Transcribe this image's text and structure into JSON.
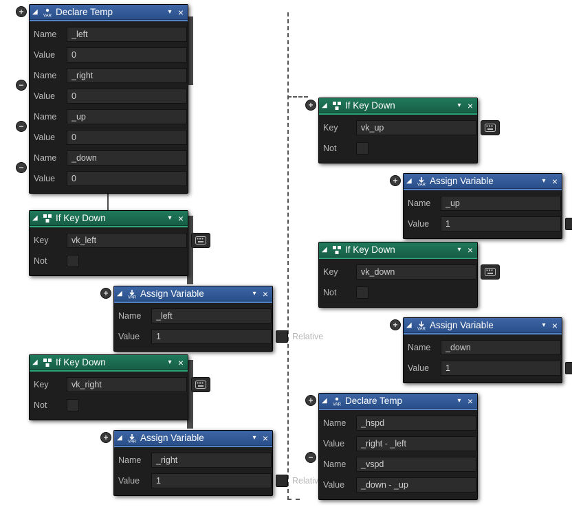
{
  "labels": {
    "name": "Name",
    "value": "Value",
    "key": "Key",
    "not": "Not",
    "relative": "Relative"
  },
  "titles": {
    "declare_temp": "Declare Temp",
    "if_key_down": "If Key Down",
    "assign_variable": "Assign Variable"
  },
  "declare1": {
    "fields": [
      {
        "name": "_left",
        "value": "0"
      },
      {
        "name": "_right",
        "value": "0"
      },
      {
        "name": "_up",
        "value": "0"
      },
      {
        "name": "_down",
        "value": "0"
      }
    ]
  },
  "if_left": {
    "key": "vk_left"
  },
  "assign_left": {
    "name": "_left",
    "value": "1"
  },
  "if_right": {
    "key": "vk_right"
  },
  "assign_right": {
    "name": "_right",
    "value": "1"
  },
  "if_up": {
    "key": "vk_up"
  },
  "assign_up": {
    "name": "_up",
    "value": "1"
  },
  "if_down": {
    "key": "vk_down"
  },
  "assign_down": {
    "name": "_down",
    "value": "1"
  },
  "declare2": {
    "fields": [
      {
        "name": "_hspd",
        "value": "_right - _left"
      },
      {
        "name": "_vspd",
        "value": "_down - _up"
      }
    ]
  }
}
